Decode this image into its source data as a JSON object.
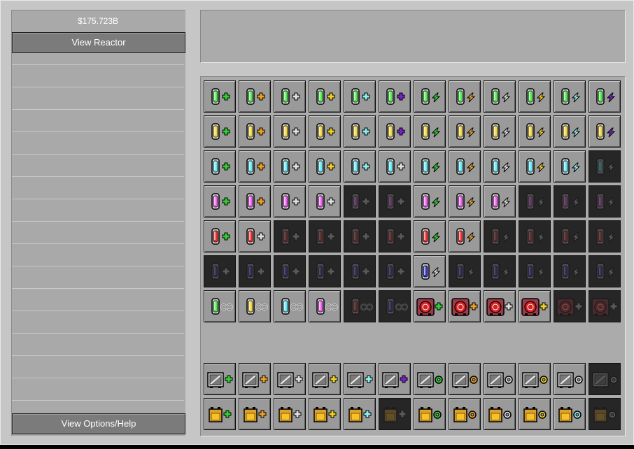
{
  "sidebar": {
    "money": "$175.723B",
    "view_reactor_label": "View Reactor",
    "options_label": "View Options/Help"
  },
  "colors": {
    "green": "#4be84b",
    "yellow": "#f0d23a",
    "cyan": "#5de6f6",
    "pink": "#f05af0",
    "red": "#f02a2a",
    "purple": "#3232c8",
    "plus_green": "#2fd22f",
    "plus_orange": "#f0a020",
    "plus_gray": "#e0e0e0",
    "plus_yellow": "#f0d020",
    "plus_cyan": "#8ff0f0",
    "plus_purple": "#7a22c8"
  },
  "rows": [
    {
      "kind": "cell",
      "color": "green",
      "items": [
        {
          "sym": "plus",
          "c": "plus_green",
          "locked": false
        },
        {
          "sym": "plus",
          "c": "plus_orange",
          "locked": false
        },
        {
          "sym": "plus",
          "c": "plus_gray",
          "locked": false
        },
        {
          "sym": "plus",
          "c": "plus_yellow",
          "locked": false
        },
        {
          "sym": "plus",
          "c": "plus_cyan",
          "locked": false
        },
        {
          "sym": "plus",
          "c": "plus_purple",
          "locked": false
        },
        {
          "sym": "bolt",
          "c": "plus_green",
          "locked": false
        },
        {
          "sym": "bolt",
          "c": "plus_orange",
          "locked": false
        },
        {
          "sym": "bolt",
          "c": "plus_gray",
          "locked": false
        },
        {
          "sym": "bolt",
          "c": "plus_yellow",
          "locked": false
        },
        {
          "sym": "bolt",
          "c": "plus_cyan",
          "locked": false
        },
        {
          "sym": "bolt",
          "c": "plus_purple",
          "locked": false
        }
      ]
    },
    {
      "kind": "cell",
      "color": "yellow",
      "items": [
        {
          "sym": "plus",
          "c": "plus_green",
          "locked": false
        },
        {
          "sym": "plus",
          "c": "plus_orange",
          "locked": false
        },
        {
          "sym": "plus",
          "c": "plus_gray",
          "locked": false
        },
        {
          "sym": "plus",
          "c": "plus_yellow",
          "locked": false
        },
        {
          "sym": "plus",
          "c": "plus_cyan",
          "locked": false
        },
        {
          "sym": "plus",
          "c": "plus_purple",
          "locked": false
        },
        {
          "sym": "bolt",
          "c": "plus_green",
          "locked": false
        },
        {
          "sym": "bolt",
          "c": "plus_orange",
          "locked": false
        },
        {
          "sym": "bolt",
          "c": "plus_gray",
          "locked": false
        },
        {
          "sym": "bolt",
          "c": "plus_yellow",
          "locked": false
        },
        {
          "sym": "bolt",
          "c": "plus_cyan",
          "locked": false
        },
        {
          "sym": "bolt",
          "c": "plus_purple",
          "locked": false
        }
      ]
    },
    {
      "kind": "cell",
      "color": "cyan",
      "items": [
        {
          "sym": "plus",
          "c": "plus_green",
          "locked": false
        },
        {
          "sym": "plus",
          "c": "plus_orange",
          "locked": false
        },
        {
          "sym": "plus",
          "c": "plus_gray",
          "locked": false
        },
        {
          "sym": "plus",
          "c": "plus_yellow",
          "locked": false
        },
        {
          "sym": "plus",
          "c": "plus_cyan",
          "locked": false
        },
        {
          "sym": "plus",
          "c": "plus_gray",
          "locked": false
        },
        {
          "sym": "bolt",
          "c": "plus_green",
          "locked": false
        },
        {
          "sym": "bolt",
          "c": "plus_orange",
          "locked": false
        },
        {
          "sym": "bolt",
          "c": "plus_gray",
          "locked": false
        },
        {
          "sym": "bolt",
          "c": "plus_yellow",
          "locked": false
        },
        {
          "sym": "bolt",
          "c": "plus_cyan",
          "locked": false
        },
        {
          "sym": "bolt",
          "c": "plus_gray",
          "locked": true
        }
      ]
    },
    {
      "kind": "cell",
      "color": "pink",
      "items": [
        {
          "sym": "plus",
          "c": "plus_green",
          "locked": false
        },
        {
          "sym": "plus",
          "c": "plus_orange",
          "locked": false
        },
        {
          "sym": "plus",
          "c": "plus_gray",
          "locked": false
        },
        {
          "sym": "plus",
          "c": "plus_gray",
          "locked": false
        },
        {
          "sym": "plus",
          "c": "plus_gray",
          "locked": true
        },
        {
          "sym": "plus",
          "c": "plus_gray",
          "locked": true
        },
        {
          "sym": "bolt",
          "c": "plus_green",
          "locked": false
        },
        {
          "sym": "bolt",
          "c": "plus_orange",
          "locked": false
        },
        {
          "sym": "bolt",
          "c": "plus_gray",
          "locked": false
        },
        {
          "sym": "bolt",
          "c": "plus_gray",
          "locked": true
        },
        {
          "sym": "bolt",
          "c": "plus_gray",
          "locked": true
        },
        {
          "sym": "bolt",
          "c": "plus_gray",
          "locked": true
        }
      ]
    },
    {
      "kind": "cell",
      "color": "red",
      "items": [
        {
          "sym": "plus",
          "c": "plus_green",
          "locked": false
        },
        {
          "sym": "plus",
          "c": "plus_gray",
          "locked": false
        },
        {
          "sym": "plus",
          "c": "plus_gray",
          "locked": true
        },
        {
          "sym": "plus",
          "c": "plus_gray",
          "locked": true
        },
        {
          "sym": "plus",
          "c": "plus_gray",
          "locked": true
        },
        {
          "sym": "plus",
          "c": "plus_gray",
          "locked": true
        },
        {
          "sym": "bolt",
          "c": "plus_green",
          "locked": false
        },
        {
          "sym": "bolt",
          "c": "plus_orange",
          "locked": false
        },
        {
          "sym": "bolt",
          "c": "plus_gray",
          "locked": true
        },
        {
          "sym": "bolt",
          "c": "plus_gray",
          "locked": true
        },
        {
          "sym": "bolt",
          "c": "plus_gray",
          "locked": true
        },
        {
          "sym": "bolt",
          "c": "plus_gray",
          "locked": true
        }
      ]
    },
    {
      "kind": "cell",
      "color": "purple",
      "items": [
        {
          "sym": "plus",
          "c": "plus_gray",
          "locked": true
        },
        {
          "sym": "plus",
          "c": "plus_gray",
          "locked": true
        },
        {
          "sym": "plus",
          "c": "plus_gray",
          "locked": true
        },
        {
          "sym": "plus",
          "c": "plus_gray",
          "locked": true
        },
        {
          "sym": "plus",
          "c": "plus_gray",
          "locked": true
        },
        {
          "sym": "plus",
          "c": "plus_gray",
          "locked": true
        },
        {
          "sym": "bolt",
          "c": "plus_gray",
          "locked": false
        },
        {
          "sym": "bolt",
          "c": "plus_gray",
          "locked": true
        },
        {
          "sym": "bolt",
          "c": "plus_gray",
          "locked": true
        },
        {
          "sym": "bolt",
          "c": "plus_gray",
          "locked": true
        },
        {
          "sym": "bolt",
          "c": "plus_gray",
          "locked": true
        },
        {
          "sym": "bolt",
          "c": "plus_gray",
          "locked": true
        }
      ]
    },
    {
      "kind": "mixed",
      "items": [
        {
          "type": "cell",
          "color": "green",
          "sym": "inf",
          "locked": false
        },
        {
          "type": "cell",
          "color": "yellow",
          "sym": "inf",
          "locked": false
        },
        {
          "type": "cell",
          "color": "cyan",
          "sym": "inf",
          "locked": false
        },
        {
          "type": "cell",
          "color": "pink",
          "sym": "inf",
          "locked": false
        },
        {
          "type": "cell",
          "color": "red",
          "sym": "inf",
          "locked": true
        },
        {
          "type": "cell",
          "color": "purple",
          "sym": "inf",
          "locked": true
        },
        {
          "type": "vent",
          "c": "plus_green",
          "locked": false
        },
        {
          "type": "vent",
          "c": "plus_orange",
          "locked": false
        },
        {
          "type": "vent",
          "c": "plus_gray",
          "locked": false
        },
        {
          "type": "vent",
          "c": "plus_yellow",
          "locked": false
        },
        {
          "type": "vent",
          "c": "plus_gray",
          "locked": true
        },
        {
          "type": "vent",
          "c": "plus_gray",
          "locked": true
        }
      ]
    },
    {
      "kind": "panel",
      "items": [
        {
          "sym": "plus",
          "c": "plus_green",
          "locked": false
        },
        {
          "sym": "plus",
          "c": "plus_orange",
          "locked": false
        },
        {
          "sym": "plus",
          "c": "plus_gray",
          "locked": false
        },
        {
          "sym": "plus",
          "c": "plus_yellow",
          "locked": false
        },
        {
          "sym": "plus",
          "c": "plus_cyan",
          "locked": false
        },
        {
          "sym": "plus",
          "c": "plus_purple",
          "locked": false
        },
        {
          "sym": "gear",
          "c": "plus_green",
          "locked": false
        },
        {
          "sym": "gear",
          "c": "plus_orange",
          "locked": false
        },
        {
          "sym": "gear",
          "c": "plus_gray",
          "locked": false
        },
        {
          "sym": "gear",
          "c": "plus_yellow",
          "locked": false
        },
        {
          "sym": "gear",
          "c": "plus_gray",
          "locked": false
        },
        {
          "sym": "gear",
          "c": "plus_gray",
          "locked": true
        }
      ]
    },
    {
      "kind": "battery",
      "items": [
        {
          "sym": "plus",
          "c": "plus_green",
          "locked": false
        },
        {
          "sym": "plus",
          "c": "plus_orange",
          "locked": false
        },
        {
          "sym": "plus",
          "c": "plus_gray",
          "locked": false
        },
        {
          "sym": "plus",
          "c": "plus_yellow",
          "locked": false
        },
        {
          "sym": "plus",
          "c": "plus_cyan",
          "locked": false
        },
        {
          "sym": "plus",
          "c": "plus_gray",
          "locked": true
        },
        {
          "sym": "gear",
          "c": "plus_green",
          "locked": false
        },
        {
          "sym": "gear",
          "c": "plus_orange",
          "locked": false
        },
        {
          "sym": "gear",
          "c": "plus_gray",
          "locked": false
        },
        {
          "sym": "gear",
          "c": "plus_yellow",
          "locked": false
        },
        {
          "sym": "gear",
          "c": "plus_cyan",
          "locked": false
        },
        {
          "sym": "gear",
          "c": "plus_gray",
          "locked": true
        }
      ]
    }
  ]
}
